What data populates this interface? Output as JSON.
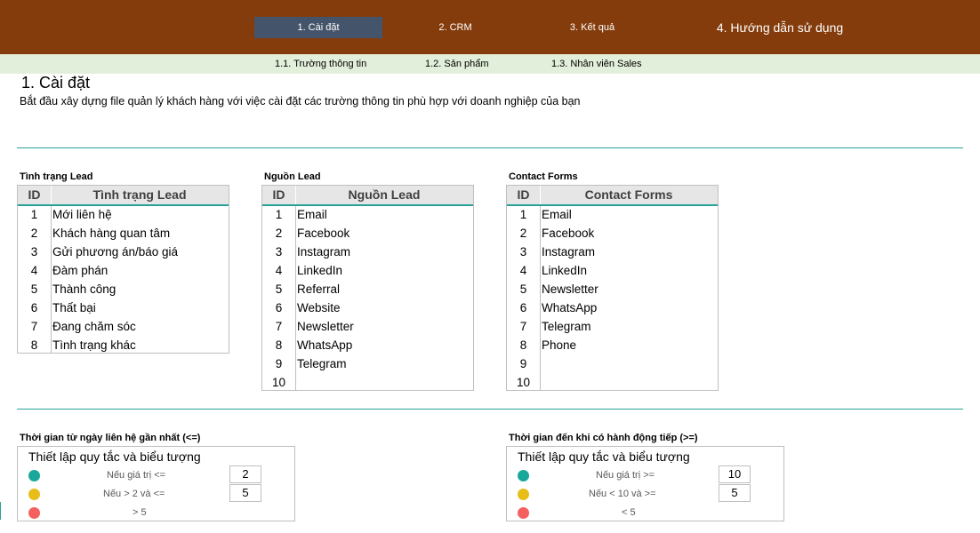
{
  "nav": {
    "tabs": [
      {
        "label": "1. Cài đặt"
      },
      {
        "label": "2. CRM"
      },
      {
        "label": "3. Kết quả"
      },
      {
        "label": "4. Hướng dẫn sử dụng"
      }
    ],
    "subtabs": [
      {
        "label": "1.1. Trường thông tin"
      },
      {
        "label": "1.2. Sản phẩm"
      },
      {
        "label": "1.3. Nhân viên Sales"
      }
    ]
  },
  "page": {
    "title": "1. Cài đặt",
    "description": "Bắt đầu xây dựng file quản lý khách hàng với việc cài đặt các trường thông tin phù hợp với doanh nghiệp của bạn"
  },
  "tables": [
    {
      "title": "Tình trạng Lead",
      "id_header": "ID",
      "name_header": "Tình trạng Lead",
      "rows": [
        {
          "id": "1",
          "name": "Mới liên hệ"
        },
        {
          "id": "2",
          "name": "Khách hàng quan tâm"
        },
        {
          "id": "3",
          "name": "Gửi phương án/báo giá"
        },
        {
          "id": "4",
          "name": "Đàm phán"
        },
        {
          "id": "5",
          "name": "Thành công"
        },
        {
          "id": "6",
          "name": "Thất bại"
        },
        {
          "id": "7",
          "name": "Đang chăm sóc"
        },
        {
          "id": "8",
          "name": "Tình trạng khác"
        }
      ]
    },
    {
      "title": "Nguồn Lead",
      "id_header": "ID",
      "name_header": "Nguồn Lead",
      "rows": [
        {
          "id": "1",
          "name": "Email"
        },
        {
          "id": "2",
          "name": "Facebook"
        },
        {
          "id": "3",
          "name": "Instagram"
        },
        {
          "id": "4",
          "name": "LinkedIn"
        },
        {
          "id": "5",
          "name": "Referral"
        },
        {
          "id": "6",
          "name": "Website"
        },
        {
          "id": "7",
          "name": "Newsletter"
        },
        {
          "id": "8",
          "name": "WhatsApp"
        },
        {
          "id": "9",
          "name": "Telegram"
        },
        {
          "id": "10",
          "name": ""
        }
      ]
    },
    {
      "title": "Contact Forms",
      "id_header": "ID",
      "name_header": "Contact Forms",
      "rows": [
        {
          "id": "1",
          "name": "Email"
        },
        {
          "id": "2",
          "name": "Facebook"
        },
        {
          "id": "3",
          "name": "Instagram"
        },
        {
          "id": "4",
          "name": "LinkedIn"
        },
        {
          "id": "5",
          "name": "Newsletter"
        },
        {
          "id": "6",
          "name": "WhatsApp"
        },
        {
          "id": "7",
          "name": "Telegram"
        },
        {
          "id": "8",
          "name": "Phone"
        },
        {
          "id": "9",
          "name": ""
        },
        {
          "id": "10",
          "name": ""
        }
      ]
    }
  ],
  "rules": [
    {
      "title": "Thời gian từ ngày liên hệ gần nhất (<=)",
      "box_title": "Thiết lập quy tắc và biểu tượng",
      "items": [
        {
          "color": "#1aa79b",
          "label": "Nếu giá trị  <=",
          "value": "2"
        },
        {
          "color": "#e8bd17",
          "label": "Nếu > 2   và   <=",
          "value": "5"
        },
        {
          "color": "#f4605e",
          "label": "> 5",
          "value": ""
        }
      ]
    },
    {
      "title": "Thời gian đến khi có hành động tiếp  (>=)",
      "box_title": "Thiết lập quy tắc và biểu tượng",
      "items": [
        {
          "color": "#1aa79b",
          "label": "Nếu giá trị  >=",
          "value": "10"
        },
        {
          "color": "#e8bd17",
          "label": "Nếu < 10   và   >=",
          "value": "5"
        },
        {
          "color": "#f4605e",
          "label": "< 5",
          "value": ""
        }
      ]
    }
  ]
}
